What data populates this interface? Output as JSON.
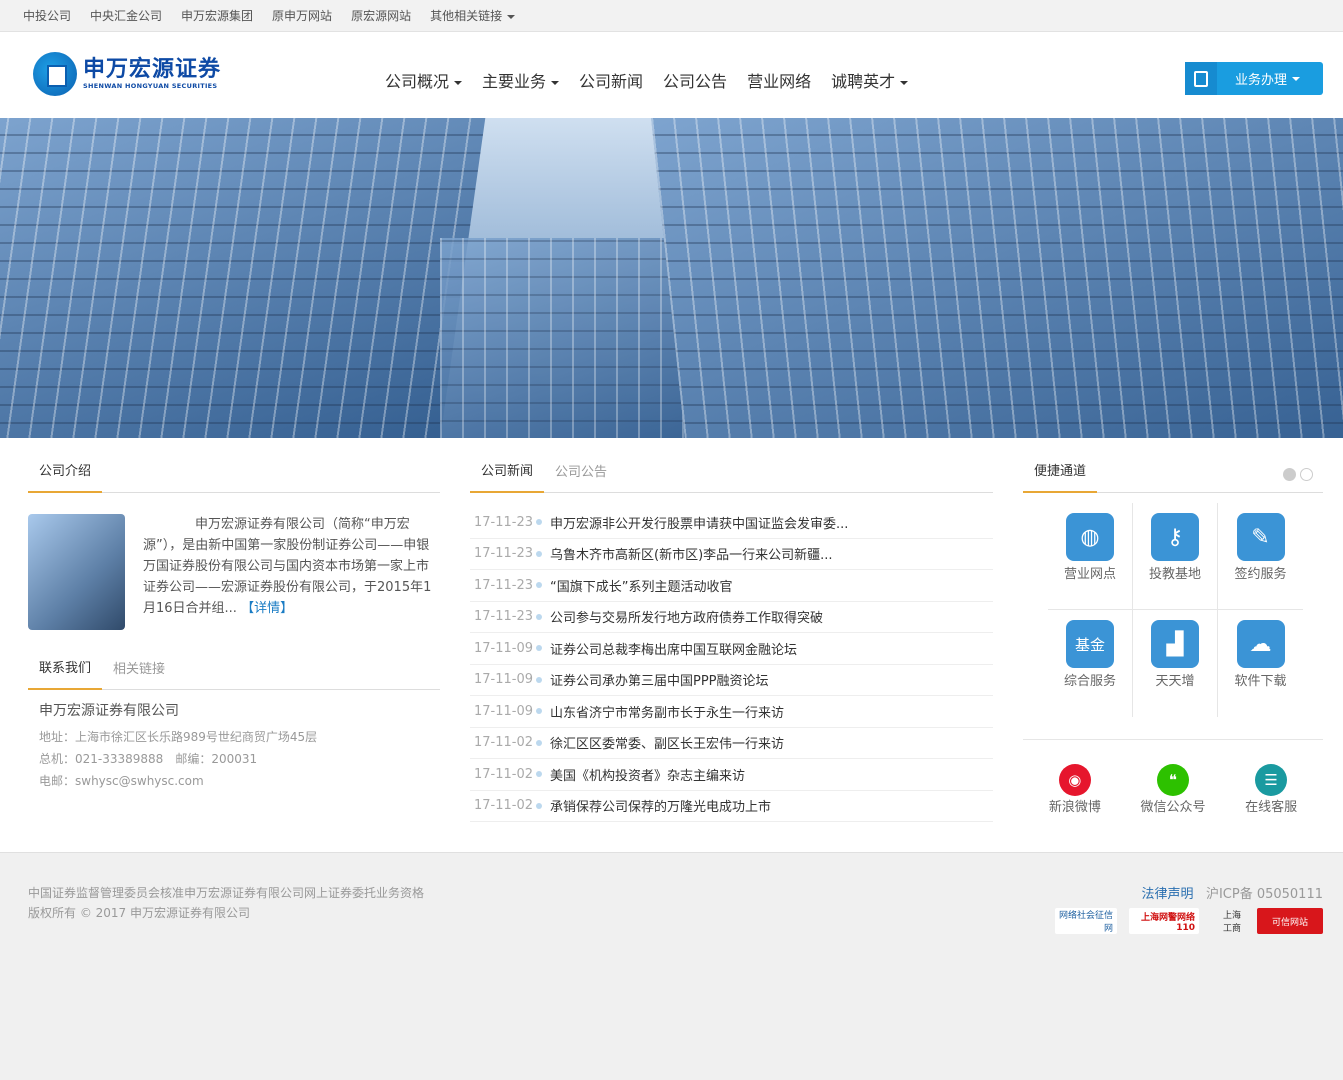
{
  "topbar": {
    "links": [
      "中投公司",
      "中央汇金公司",
      "申万宏源集团",
      "原申万网站",
      "原宏源网站"
    ],
    "more": "其他相关链接"
  },
  "logo": {
    "cn": "申万宏源证券",
    "en": "SHENWAN HONGYUAN SECURITIES"
  },
  "nav": [
    {
      "label": "公司概况",
      "dropdown": true
    },
    {
      "label": "主要业务",
      "dropdown": true
    },
    {
      "label": "公司新闻"
    },
    {
      "label": "公司公告"
    },
    {
      "label": "营业网络"
    },
    {
      "label": "诚聘英才",
      "dropdown": true
    }
  ],
  "biz_button": "业务办理",
  "intro": {
    "tab": "公司介绍",
    "text": "申万宏源证券有限公司（简称“申万宏源”），是由新中国第一家股份制证券公司——申银万国证券股份有限公司与国内资本市场第一家上市证券公司——宏源证券股份有限公司，于2015年1月16日合并组...",
    "more": "【详情】"
  },
  "contact": {
    "tabs": [
      "联系我们",
      "相关链接"
    ],
    "company": "申万宏源证券有限公司",
    "address": "地址：上海市徐汇区长乐路989号世纪商贸广场45层",
    "phone": "总机：021-33389888　邮编：200031",
    "email": "电邮：swhysc@swhysc.com"
  },
  "news": {
    "tabs": [
      "公司新闻",
      "公司公告"
    ],
    "items": [
      {
        "date": "17-11-23",
        "title": "申万宏源非公开发行股票申请获中国证监会发审委..."
      },
      {
        "date": "17-11-23",
        "title": "乌鲁木齐市高新区(新市区)李品一行来公司新疆..."
      },
      {
        "date": "17-11-23",
        "title": "“国旗下成长”系列主题活动收官"
      },
      {
        "date": "17-11-23",
        "title": "公司参与交易所发行地方政府债券工作取得突破"
      },
      {
        "date": "17-11-09",
        "title": "证券公司总裁李梅出席中国互联网金融论坛"
      },
      {
        "date": "17-11-09",
        "title": "证券公司承办第三届中国PPP融资论坛"
      },
      {
        "date": "17-11-09",
        "title": "山东省济宁市常务副市长于永生一行来访"
      },
      {
        "date": "17-11-02",
        "title": "徐汇区区委常委、副区长王宏伟一行来访"
      },
      {
        "date": "17-11-02",
        "title": "美国《机构投资者》杂志主编来访"
      },
      {
        "date": "17-11-02",
        "title": "承销保荐公司保荐的万隆光电成功上市"
      }
    ]
  },
  "quick": {
    "tab": "便捷通道",
    "items": [
      {
        "label": "营业网点",
        "icon": "globe-icon"
      },
      {
        "label": "投教基地",
        "icon": "key-chart-icon"
      },
      {
        "label": "签约服务",
        "icon": "feather-icon"
      },
      {
        "label": "综合服务",
        "icon": "fund-icon",
        "icon_text": "基金"
      },
      {
        "label": "天天增",
        "icon": "growth-chart-icon"
      },
      {
        "label": "软件下载",
        "icon": "cloud-download-icon"
      }
    ],
    "social": [
      {
        "label": "新浪微博",
        "color": "#e6162d"
      },
      {
        "label": "微信公众号",
        "color": "#2dc100"
      },
      {
        "label": "在线客服",
        "color": "#1a9aa0"
      }
    ]
  },
  "footer": {
    "line1": "中国证券监督管理委员会核准申万宏源证券有限公司网上证券委托业务资格",
    "line2": "版权所有 © 2017 申万宏源证券有限公司",
    "legal": "法律声明",
    "icp": "沪ICP备 05050111",
    "badges": [
      "网络社会征信网",
      "上海网警网络110",
      "上海工商",
      "可信网站"
    ]
  }
}
